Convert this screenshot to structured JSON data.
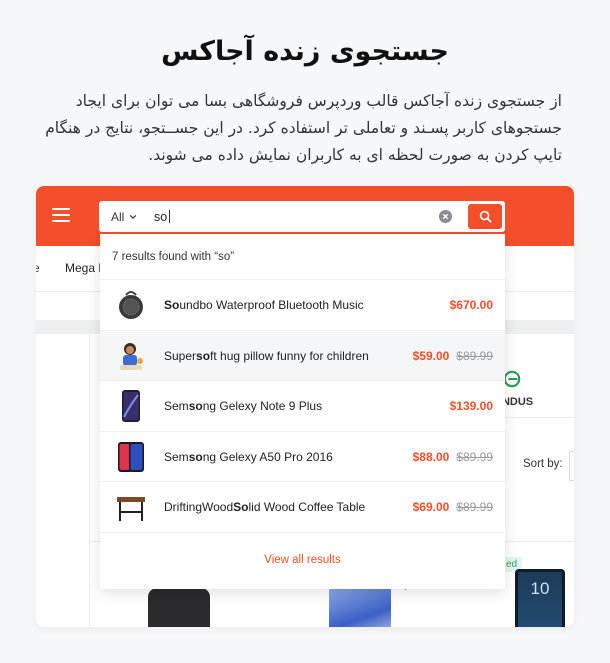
{
  "page": {
    "title": "جستجوی زنده آجاکس",
    "description": "از جستجوی زنده آجاکس قالب وردپرس فروشگاهی بسا می توان برای ایجاد جستجوهای کاربر پسـند و تعاملی تر استفاده کرد. در این جســتجو، نتایج در هنگام تایپ کردن به صورت لحظه ای به کاربران نمایش داده می شوند."
  },
  "colors": {
    "accent": "#f54e2a",
    "background": "#f6f7f9",
    "header_bar": "#f54e2a"
  },
  "search": {
    "category": "All",
    "query": "so",
    "clear_icon": "clear-circle-icon",
    "submit_icon": "search-icon"
  },
  "background_site": {
    "nav_partial": "e",
    "nav_mega": "Mega M",
    "brand_name": "UNDUS",
    "sort_label": "Sort by:",
    "badge": "ed",
    "phone_number": "10"
  },
  "dropdown": {
    "summary": "7 results found with “so”",
    "view_all": "View all results",
    "results": [
      {
        "before": "",
        "match": "So",
        "after": "undbo Waterproof Bluetooth Music",
        "price": "$670.00",
        "old_price": "",
        "icon": "speaker-thumb",
        "hovered": false
      },
      {
        "before": "Super ",
        "match": "so",
        "after": "ft hug pillow funny for children",
        "price": "$59.00",
        "old_price": "$89.99",
        "icon": "pillow-thumb",
        "hovered": true
      },
      {
        "before": "Sem",
        "match": "so",
        "after": "ng Gelexy Note 9 Plus",
        "price": "$139.00",
        "old_price": "",
        "icon": "phone-note-thumb",
        "hovered": false
      },
      {
        "before": "Sem",
        "match": "so",
        "after": "ng Gelexy A50 Pro 2016",
        "price": "$88.00",
        "old_price": "$89.99",
        "icon": "phone-a50-thumb",
        "hovered": false
      },
      {
        "before": "DriftingWood ",
        "match": "So",
        "after": "lid Wood Coffee Table",
        "price": "$69.00",
        "old_price": "$89.99",
        "icon": "table-thumb",
        "hovered": false
      }
    ]
  }
}
